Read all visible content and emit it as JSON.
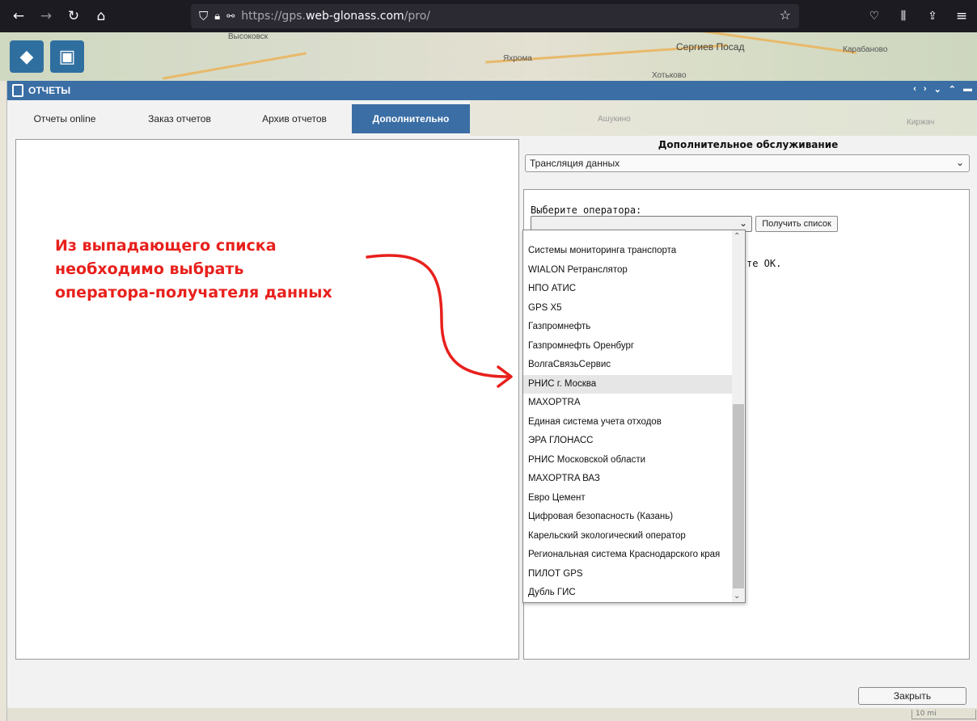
{
  "browser": {
    "url_prefix": "https://gps.",
    "url_domain": "web-glonass.com",
    "url_path": "/pro/"
  },
  "map": {
    "labels": [
      "Высоковск",
      "Яхрома",
      "Сергиев Посад",
      "Хотьково",
      "Карабаново",
      "Ашукино",
      "Киржач"
    ]
  },
  "window": {
    "title": "ОТЧЕТЫ"
  },
  "tabs": [
    {
      "label": "Отчеты online"
    },
    {
      "label": "Заказ отчетов"
    },
    {
      "label": "Архив отчетов"
    },
    {
      "label": "Дополнительно"
    }
  ],
  "annotation": {
    "line1": "Из выпадающего списка",
    "line2": "необходимо выбрать",
    "line3": "оператора-получателя данных"
  },
  "right": {
    "title": "Дополнительное обслуживание",
    "service_value": "Трансляция данных",
    "operator_label": "Выберите оператора:",
    "operator_value": "",
    "get_list_label": "Получить список",
    "hint_text": "те OK."
  },
  "dropdown": {
    "items": [
      "Системы мониторинга транспорта",
      "WIALON Ретранслятор",
      "НПО АТИС",
      "GPS X5",
      "Газпромнефть",
      "Газпромнефть Оренбург",
      "ВолгаСвязьСервис",
      "РНИС г. Москва",
      "MAXOPTRA",
      "Единая система учета отходов",
      "ЭРА ГЛОНАСС",
      "РНИС Московской области",
      "MAXOPTRA ВАЗ",
      "Евро Цемент",
      "Цифровая безопасность (Казань)",
      "Карельский экологический оператор",
      "Региональная система Краснодарского края",
      "ПИЛОТ GPS",
      "Дубль ГИС"
    ],
    "highlighted": "РНИС г. Москва"
  },
  "footer": {
    "close_label": "Закрыть",
    "scale_label": "10 mi"
  },
  "colors": {
    "accent": "#3a6ea5",
    "annotation": "#e8201c",
    "browser_bg": "#1c1b22"
  }
}
